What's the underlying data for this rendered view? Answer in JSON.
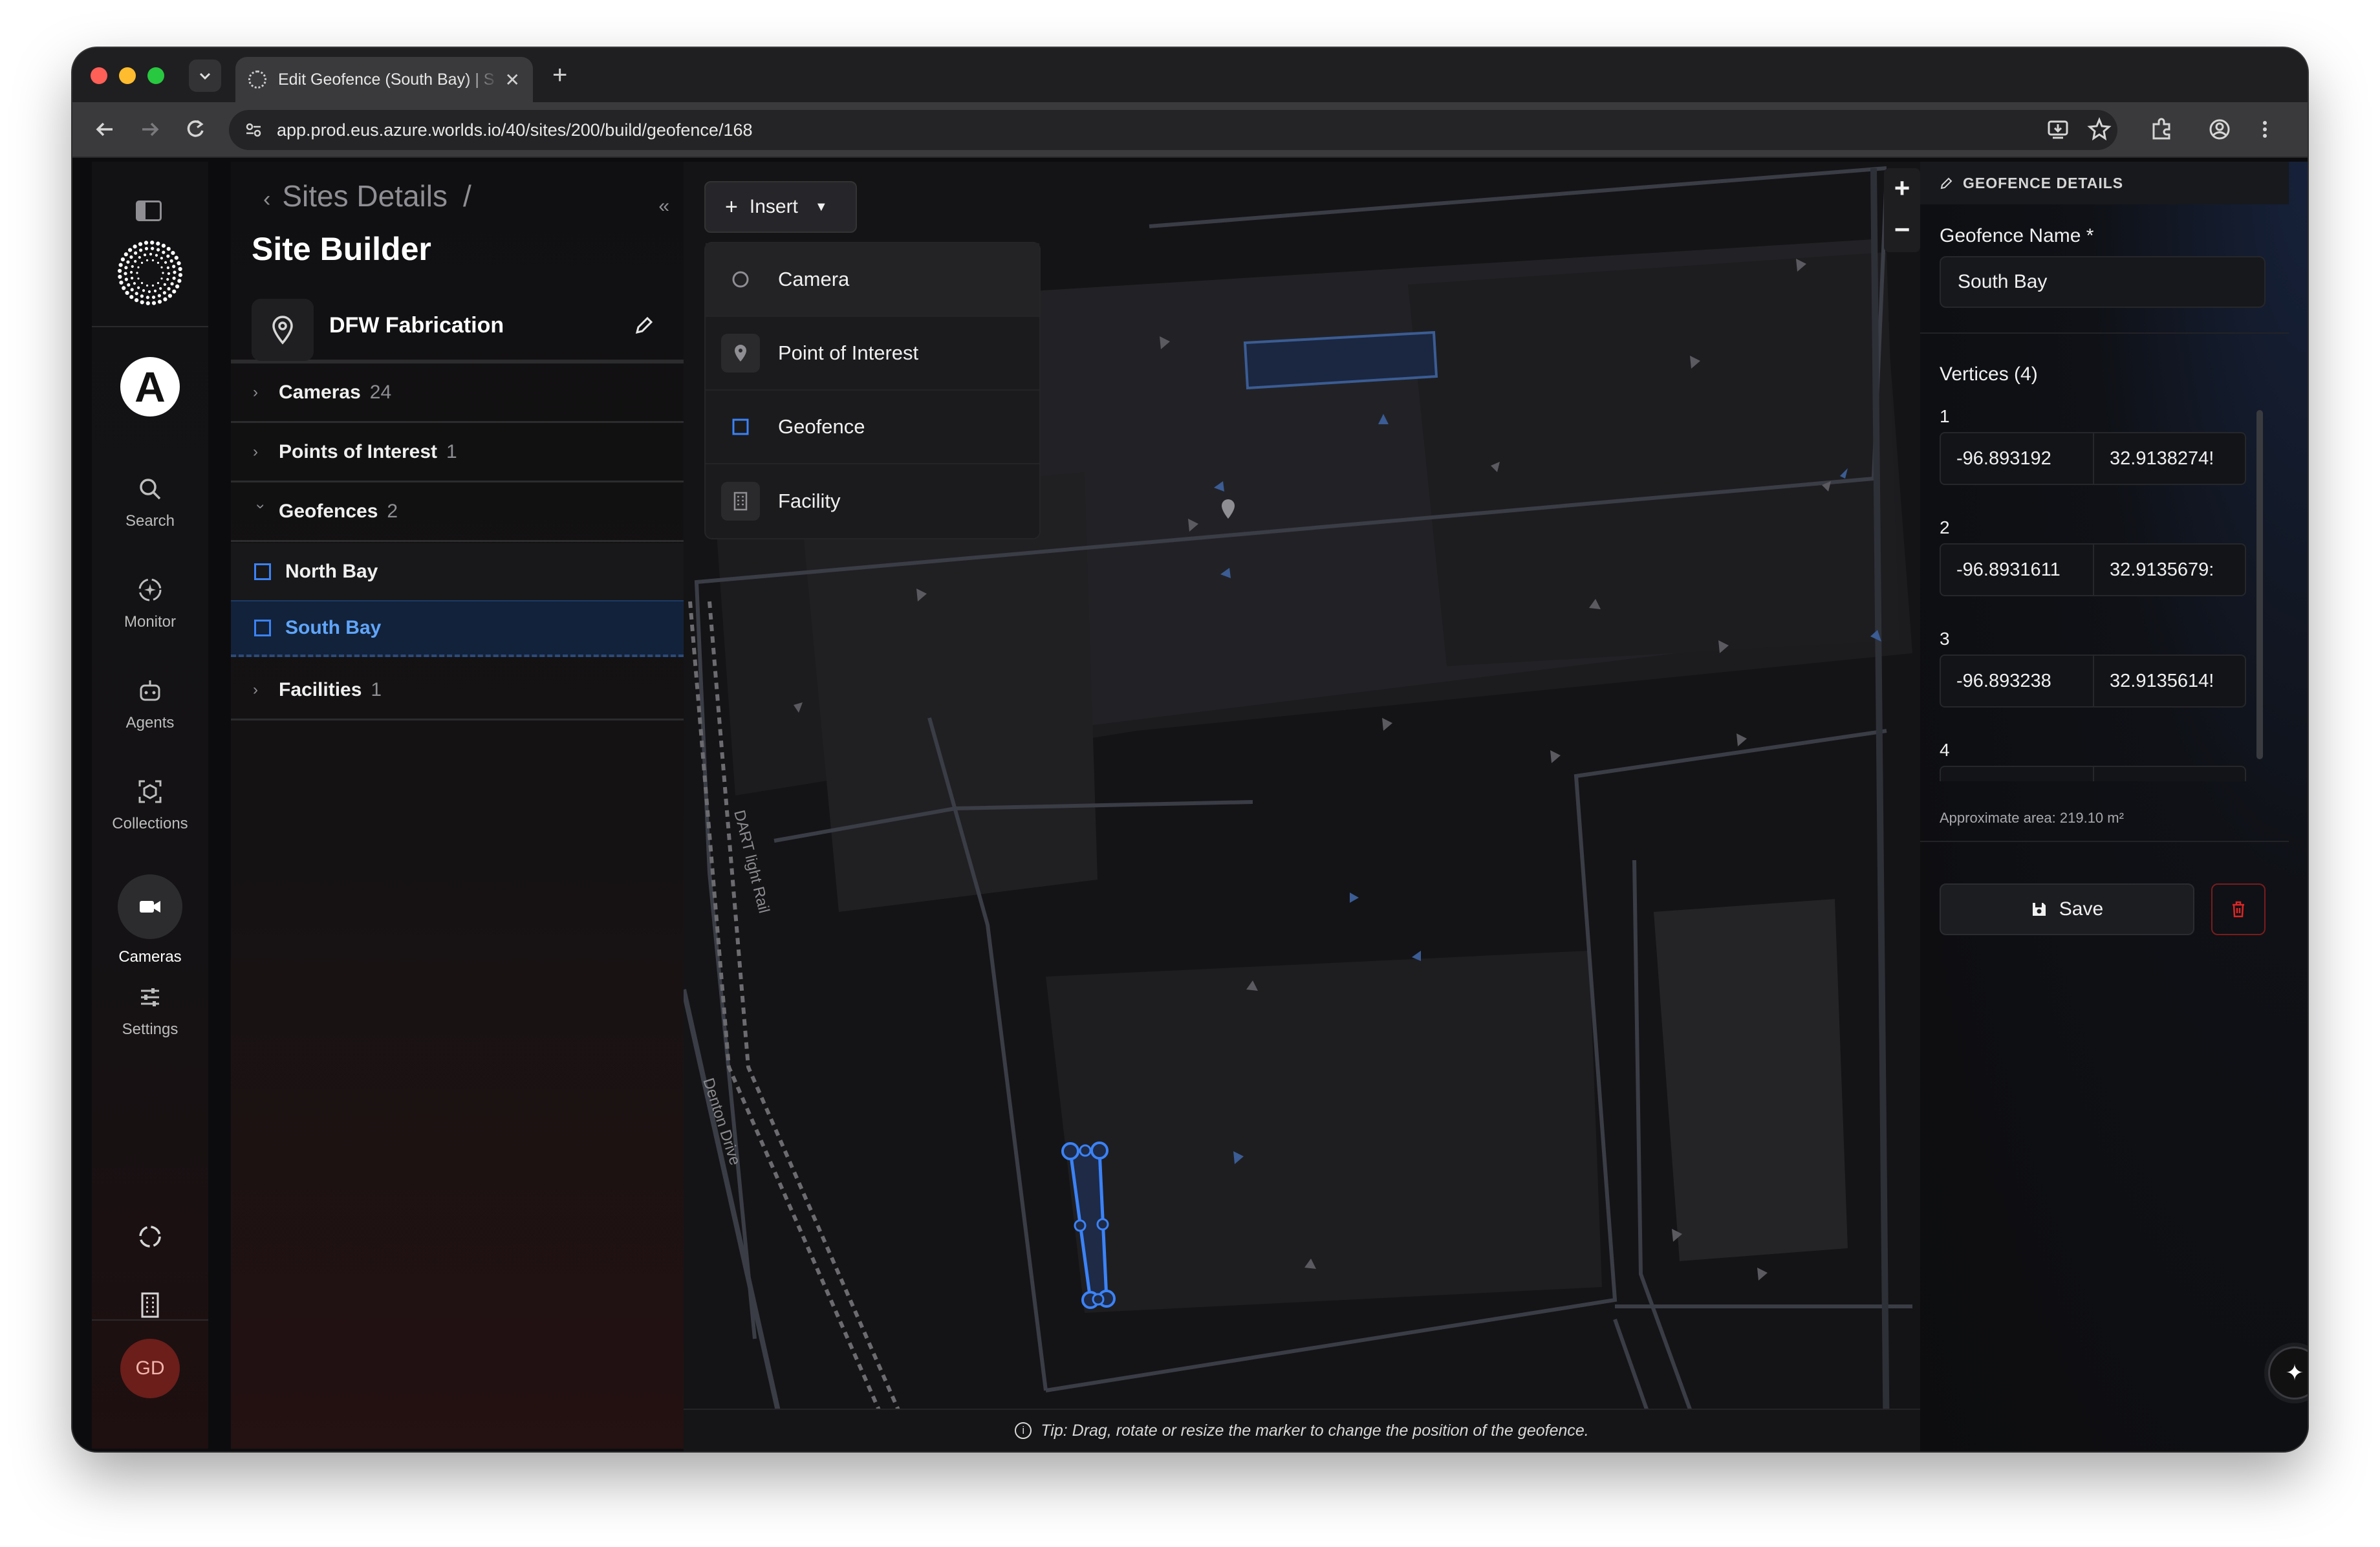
{
  "browser": {
    "tab_title": "Edit Geofence (South Bay) | S",
    "url": "app.prod.eus.azure.worlds.io/40/sites/200/build/geofence/168",
    "close_glyph": "✕",
    "new_tab_glyph": "+"
  },
  "rail": {
    "items": [
      {
        "label": "Search",
        "icon": "search-icon"
      },
      {
        "label": "Monitor",
        "icon": "monitor-icon"
      },
      {
        "label": "Agents",
        "icon": "robot-icon"
      },
      {
        "label": "Collections",
        "icon": "collections-icon"
      },
      {
        "label": "Cameras",
        "icon": "camera-icon"
      },
      {
        "label": "Settings",
        "icon": "sliders-icon"
      }
    ],
    "avatar_initials": "GD"
  },
  "panel": {
    "breadcrumb": "Sites Details",
    "breadcrumb_sep": "/",
    "title": "Site Builder",
    "site_name": "DFW Fabrication",
    "sections": [
      {
        "name": "Cameras",
        "count": "24"
      },
      {
        "name": "Points of Interest",
        "count": "1"
      },
      {
        "name": "Geofences",
        "count": "2"
      },
      {
        "name": "Facilities",
        "count": "1"
      }
    ],
    "geofences": [
      "North Bay",
      "South Bay"
    ]
  },
  "map": {
    "insert_label": "Insert",
    "insert_menu": [
      "Camera",
      "Point of Interest",
      "Geofence",
      "Facility"
    ],
    "zoom_in": "+",
    "zoom_out": "−",
    "street_labels": [
      "DART light Rail",
      "Denton Drive"
    ],
    "tip": "Tip: Drag, rotate or resize the marker to change the position of the geofence.",
    "geofence_color": "#3b82f6"
  },
  "details": {
    "header": "GEOFENCE DETAILS",
    "name_label": "Geofence Name *",
    "name_value": "South Bay",
    "vertices_label": "Vertices (4)",
    "vertices": [
      {
        "index": "1",
        "lng": "-96.893192",
        "lat": "32.9138274!"
      },
      {
        "index": "2",
        "lng": "-96.8931611",
        "lat": "32.9135679:"
      },
      {
        "index": "3",
        "lng": "-96.893238",
        "lat": "32.9135614!"
      },
      {
        "index": "4",
        "lng": "",
        "lat": ""
      }
    ],
    "area": "Approximate area: 219.10 m²",
    "save_label": "Save"
  }
}
